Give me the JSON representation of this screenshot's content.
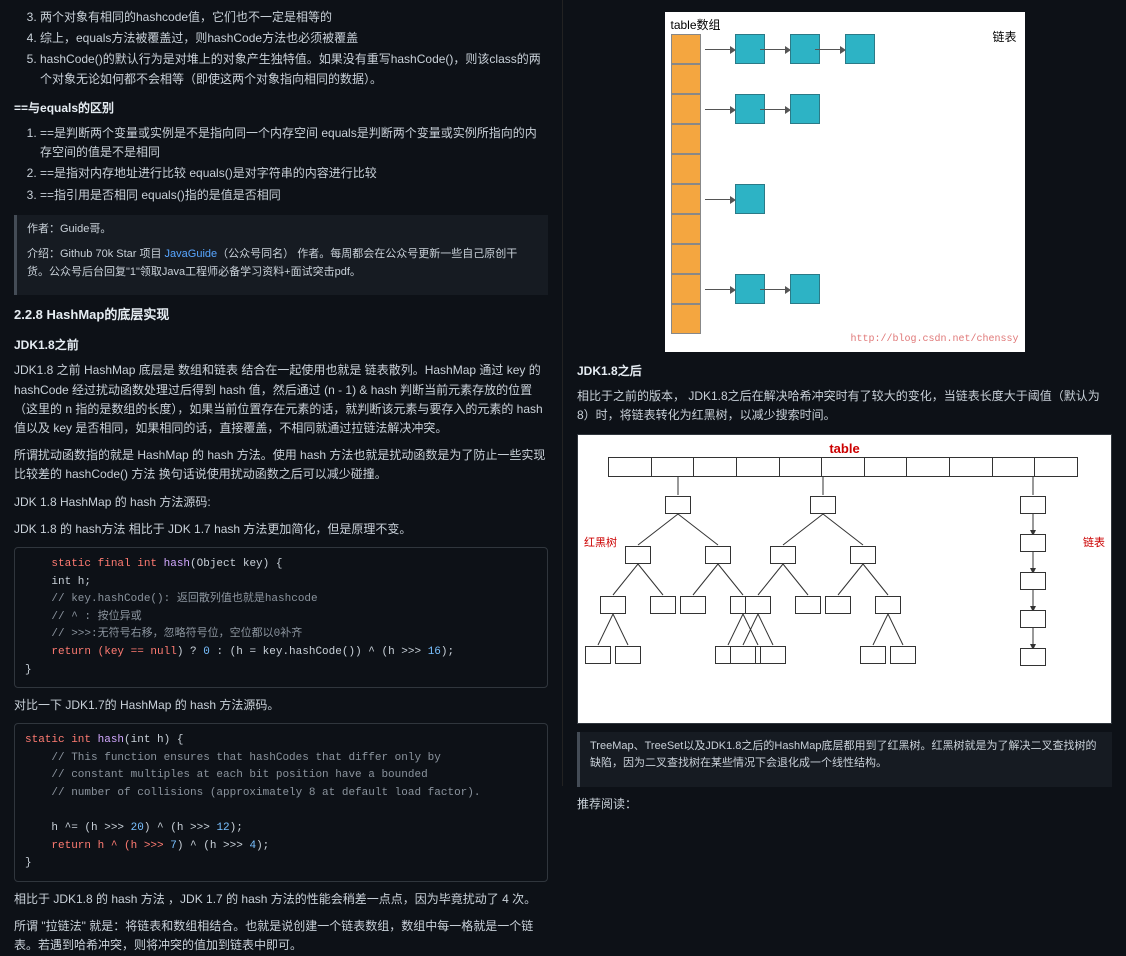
{
  "left": {
    "list1": {
      "start": 3,
      "items": [
        "两个对象有相同的hashcode值，它们也不一定是相等的",
        "综上，equals方法被覆盖过，则hashCode方法也必须被覆盖",
        "hashCode()的默认行为是对堆上的对象产生独特值。如果没有重写hashCode()，则该class的两个对象无论如何都不会相等（即使这两个对象指向相同的数据）。"
      ]
    },
    "sub1_title": "==与equals的区别",
    "list2": [
      "==是判断两个变量或实例是不是指向同一个内存空间 equals是判断两个变量或实例所指向的内存空间的值是不是相同",
      "==是指对内存地址进行比较 equals()是对字符串的内容进行比较",
      "==指引用是否相同 equals()指的是值是否相同"
    ],
    "quote": {
      "line1": "作者：Guide哥。",
      "line2a": "介绍：Github 70k Star 项目 ",
      "link": "JavaGuide",
      "line2b": "（公众号同名） 作者。每周都会在公众号更新一些自己原创干货。公众号后台回复\"1\"领取Java工程师必备学习资料+面试突击pdf。"
    },
    "h228": "2.2.8 HashMap的底层实现",
    "h_before": "JDK1.8之前",
    "p1": "JDK1.8 之前 HashMap 底层是 数组和链表 结合在一起使用也就是 链表散列。HashMap 通过 key 的 hashCode 经过扰动函数处理过后得到 hash 值，然后通过 (n - 1) & hash 判断当前元素存放的位置（这里的 n 指的是数组的长度），如果当前位置存在元素的话，就判断该元素与要存入的元素的 hash 值以及 key 是否相同，如果相同的话，直接覆盖，不相同就通过拉链法解决冲突。",
    "p2": "所谓扰动函数指的就是 HashMap 的 hash 方法。使用 hash 方法也就是扰动函数是为了防止一些实现比较差的 hashCode() 方法 换句话说使用扰动函数之后可以减少碰撞。",
    "p3": "JDK 1.8 HashMap 的 hash 方法源码:",
    "p4": "JDK 1.8 的 hash方法 相比于 JDK 1.7 hash 方法更加简化，但是原理不变。",
    "p5": "对比一下 JDK1.7的 HashMap 的 hash 方法源码。",
    "p6": "相比于 JDK1.8 的 hash 方法 ，JDK 1.7 的 hash 方法的性能会稍差一点点，因为毕竟扰动了 4 次。",
    "p7": "所谓 \"拉链法\" 就是：将链表和数组相结合。也就是说创建一个链表数组，数组中每一格就是一个链表。若遇到哈希冲突，则将冲突的值加到链表中即可。",
    "code1": {
      "l1_a": "static final int ",
      "l1_fn": "hash",
      "l1_b": "(Object key) {",
      "l2": "    int h;",
      "l3": "    // key.hashCode(): 返回散列值也就是hashcode",
      "l4": "    // ^ : 按位异或",
      "l5": "    // >>>:无符号右移，忽略符号位，空位都以0补齐",
      "l6_a": "    return (key == ",
      "l6_null": "null",
      "l6_b": ") ? ",
      "l6_n0": "0",
      "l6_c": " : (h = key.hashCode()) ^ (h >>> ",
      "l6_n16": "16",
      "l6_d": ");",
      "l7": "}"
    },
    "code2": {
      "l1_a": "static int ",
      "l1_fn": "hash",
      "l1_b": "(int h) {",
      "l2": "    // This function ensures that hashCodes that differ only by",
      "l3": "    // constant multiples at each bit position have a bounded",
      "l4": "    // number of collisions (approximately 8 at default load factor).",
      "l5": "",
      "l6_a": "    h ^= (h >>> ",
      "l6_n1": "20",
      "l6_b": ") ^ (h >>> ",
      "l6_n2": "12",
      "l6_c": ");",
      "l7_a": "    return h ^ (h >>> ",
      "l7_n1": "7",
      "l7_b": ") ^ (h >>> ",
      "l7_n2": "4",
      "l7_c": ");",
      "l8": "}"
    }
  },
  "right": {
    "d1": {
      "title": "table数组",
      "ltext": "链表",
      "watermark": "http://blog.csdn.net/chenssy"
    },
    "h_after": "JDK1.8之后",
    "p1": "相比于之前的版本， JDK1.8之后在解决哈希冲突时有了较大的变化，当链表长度大于阈值（默认为8）时，将链表转化为红黑树，以减少搜索时间。",
    "d2": {
      "table": "table",
      "rb": "红黑树",
      "ll": "链表"
    },
    "quote2": "TreeMap、TreeSet以及JDK1.8之后的HashMap底层都用到了红黑树。红黑树就是为了解决二叉查找树的缺陷，因为二叉查找树在某些情况下会退化成一个线性结构。",
    "p2": "推荐阅读："
  }
}
